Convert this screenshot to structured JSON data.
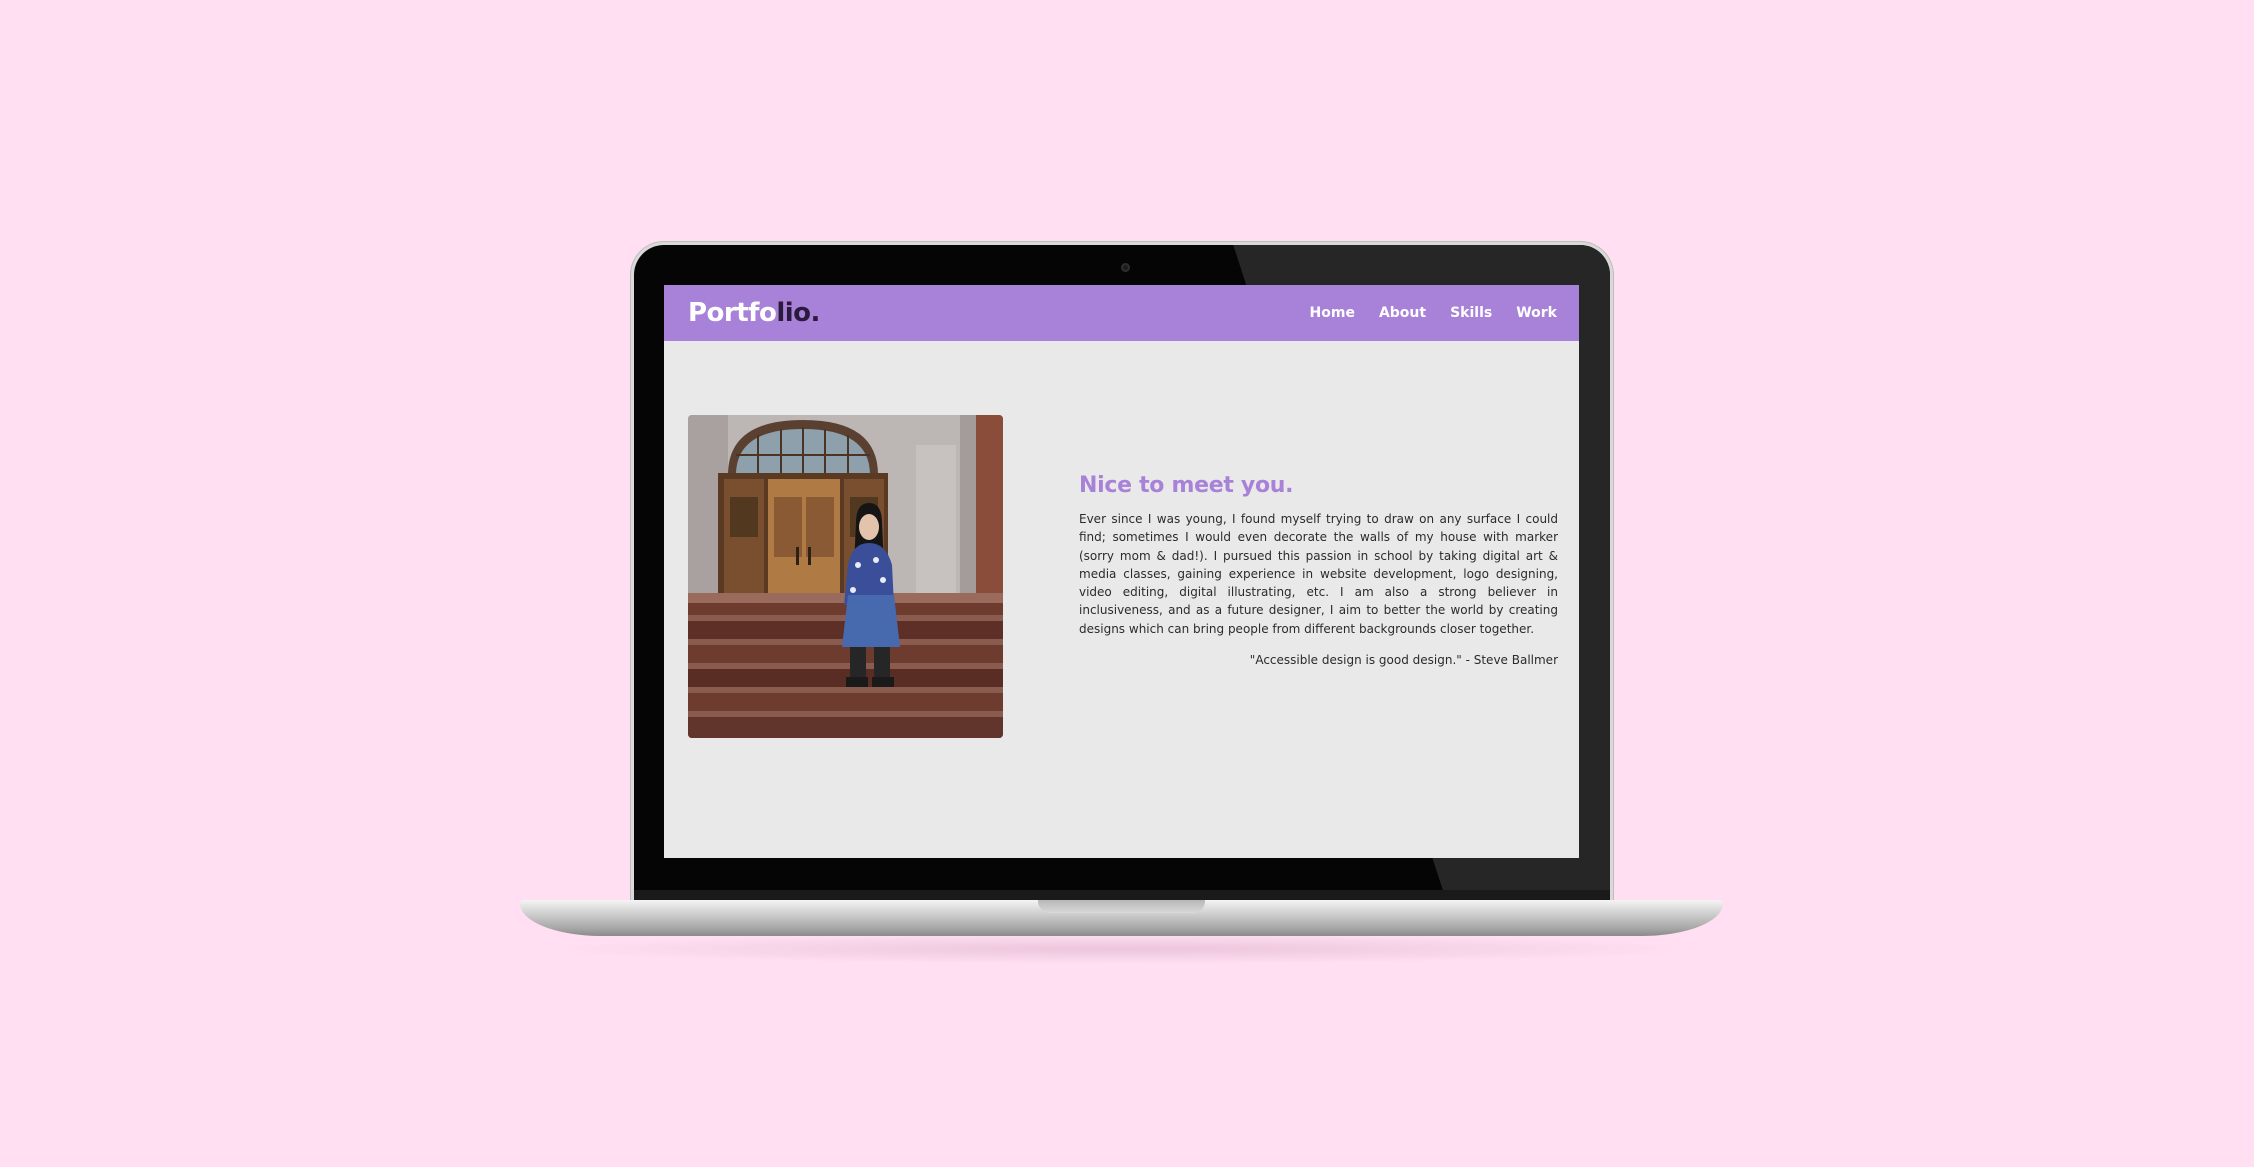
{
  "page": {
    "background_color": "#ffdff1",
    "accent_color": "#a782d8"
  },
  "navbar": {
    "logo_light": "Portfo",
    "logo_dark": "lio.",
    "links": [
      {
        "label": "Home"
      },
      {
        "label": "About"
      },
      {
        "label": "Skills"
      },
      {
        "label": "Work"
      }
    ]
  },
  "about": {
    "photo_icon": "portrait-photo",
    "title": "Nice to meet you.",
    "text": "Ever since I was young, I found myself trying to draw on any surface I could find; sometimes I would even decorate the walls of my house with marker (sorry mom & dad!). I pursued this passion in school by taking digital art & media classes, gaining experience in website development, logo designing, video editing, digital illustrating, etc. I am also a strong believer in inclusiveness, and as a future designer, I aim to better the world by creating designs which can bring people from different backgrounds closer together.",
    "quote": "\"Accessible design is good design.\" - Steve Ballmer"
  }
}
